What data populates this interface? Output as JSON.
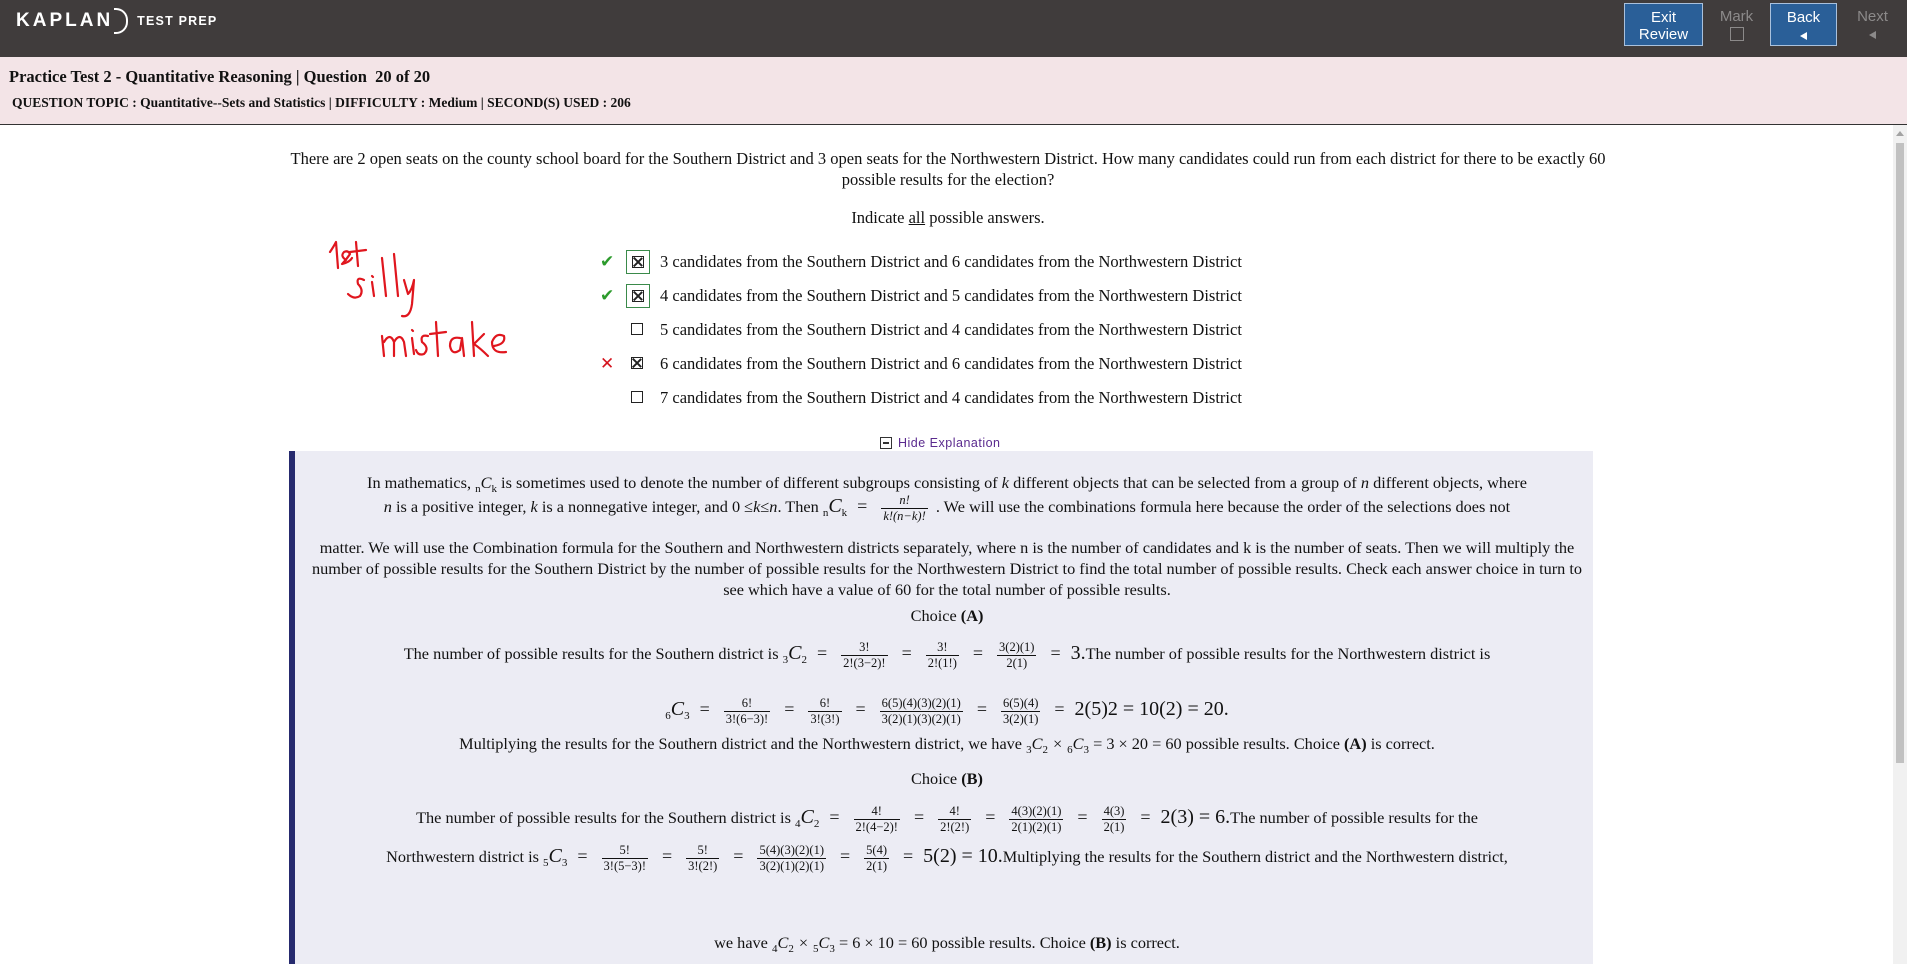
{
  "brand": {
    "logo": "KAPLAN",
    "sub": "TEST PREP"
  },
  "nav": {
    "exit_line1": "Exit",
    "exit_line2": "Review",
    "mark": "Mark",
    "back": "Back",
    "next": "Next"
  },
  "header": {
    "title": "Practice Test 2 - Quantitative Reasoning | Question  20 of 20",
    "meta": "QUESTION TOPIC : Quantitative--Sets and Statistics | DIFFICULTY : Medium | SECOND(S) USED : 206"
  },
  "question": {
    "stem": "There are 2 open seats on the county school board for the Southern District and 3 open seats for the Northwestern District. How many candidates could run from each district for there to be exactly 60 possible results for the election?",
    "indicate_pre": "Indicate ",
    "indicate_all": "all",
    "indicate_post": " possible answers.",
    "choices": [
      {
        "text": "3 candidates from the Southern District and 6 candidates from the Northwestern District",
        "checked": true,
        "status": "correct"
      },
      {
        "text": "4 candidates from the Southern District and 5 candidates from the Northwestern District",
        "checked": true,
        "status": "correct"
      },
      {
        "text": "5 candidates from the Southern District and 4 candidates from the Northwestern District",
        "checked": false,
        "status": "none"
      },
      {
        "text": "6 candidates from the Southern District and 6 candidates from the Northwestern District",
        "checked": true,
        "status": "wrong"
      },
      {
        "text": "7 candidates from the Southern District and 4 candidates from the Northwestern District",
        "checked": false,
        "status": "none"
      }
    ]
  },
  "annotation": {
    "lines": [
      "1st",
      "silly",
      "mistake"
    ],
    "color": "#e0161e"
  },
  "explanation": {
    "toggle": "Hide Explanation",
    "p1_a": "In mathematics, ",
    "p1_b": " is sometimes used to denote the number of different subgroups consisting of ",
    "p1_k": "k",
    "p1_c": " different objects that can be selected from a group of ",
    "p1_n": "n",
    "p1_d": " different objects, where",
    "p2_a": "n",
    "p2_b": " is a positive integer, ",
    "p2_c": "k",
    "p2_d": " is a nonnegative integer, and 0 ≤",
    "p2_e": "k",
    "p2_f": "≤",
    "p2_g": "n",
    "p2_h": ". Then ",
    "formula_num": "n!",
    "formula_den": "k!(n−k)!",
    "p2_i": " . We will use the combinations formula here because the order of the selections does not",
    "p3": "matter. We will use the Combination formula for the Southern and Northwestern districts separately, where n is the number of candidates and k is the number of seats. Then we will multiply the number of possible results for the Southern District by the number of possible results for the Northwestern District to find the total number of possible results. Check each answer choice in turn to see which have a value of 60 for the total number of possible results.",
    "choiceA_label": "Choice ",
    "choiceA_letter": "(A)",
    "a_line1_pre": "The number of possible results for the Southern district is ",
    "a_f1n": "3!",
    "a_f1d": "2!(3−2)!",
    "a_f2n": "3!",
    "a_f2d": "2!(1!)",
    "a_f3n": "3(2)(1)",
    "a_f3d": "2(1)",
    "a_res1": "3.",
    "a_line1_post": "The number of possible results for the Northwestern district is",
    "a_g1n": "6!",
    "a_g1d": "3!(6−3)!",
    "a_g2n": "6!",
    "a_g2d": "3!(3!)",
    "a_g3n": "6(5)(4)(3)(2)(1)",
    "a_g3d": "3(2)(1)(3)(2)(1)",
    "a_g4n": "6(5)(4)",
    "a_g4d": "3(2)(1)",
    "a_res2": "2(5)2 = 10(2) = 20.",
    "a_mult_pre": "Multiplying the results for the Southern district and the Northwestern district, we have ",
    "a_mult_mid": " = 3 × 20 = 60 possible results. Choice ",
    "a_mult_letter": "(A)",
    "a_mult_post": " is correct.",
    "choiceB_label": "Choice ",
    "choiceB_letter": "(B)",
    "b_line1_pre": "The number of possible results for the Southern district is ",
    "b_f1n": "4!",
    "b_f1d": "2!(4−2)!",
    "b_f2n": "4!",
    "b_f2d": "2!(2!)",
    "b_f3n": "4(3)(2)(1)",
    "b_f3d": "2(1)(2)(1)",
    "b_f4n": "4(3)",
    "b_f4d": "2(1)",
    "b_res1": "2(3) = 6.",
    "b_line1_post": "The number of possible results for the",
    "b_line2_pre": "Northwestern district is ",
    "b_g1n": "5!",
    "b_g1d": "3!(5−3)!",
    "b_g2n": "5!",
    "b_g2d": "3!(2!)",
    "b_g3n": "5(4)(3)(2)(1)",
    "b_g3d": "3(2)(1)(2)(1)",
    "b_g4n": "5(4)",
    "b_g4d": "2(1)",
    "b_res2": "5(2) = 10.",
    "b_line2_post": "Multiplying the results for the Southern district and the Northwestern district,",
    "b_mult_pre": "we have ",
    "b_mult_mid": " = 6 × 10 = 60 possible results. Choice ",
    "b_mult_letter": "(B)",
    "b_mult_post": " is correct."
  }
}
